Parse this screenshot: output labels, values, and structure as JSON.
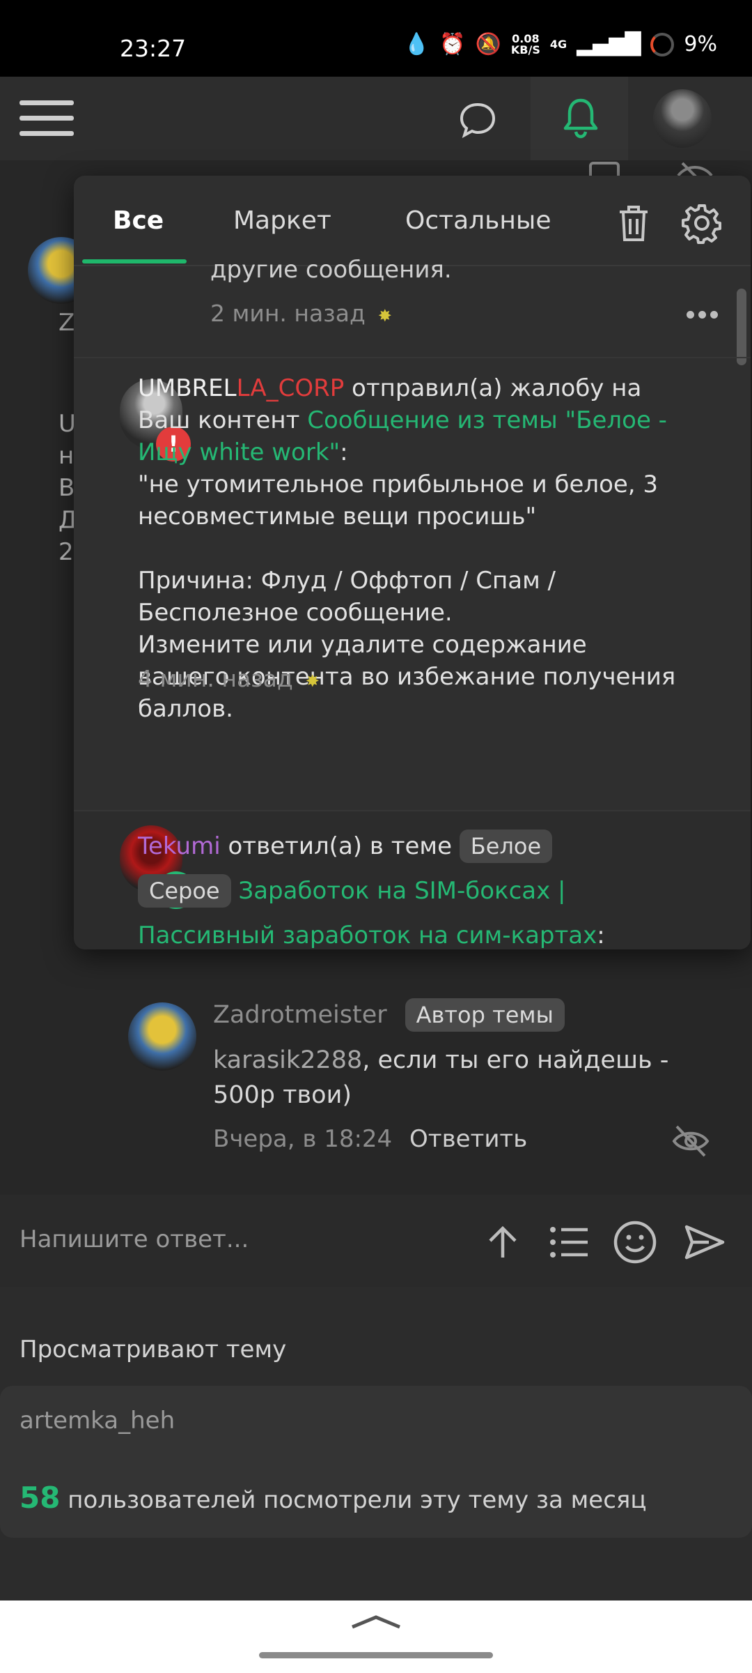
{
  "status_bar": {
    "time": "23:27",
    "speed_value": "0.08",
    "speed_unit": "KB/S",
    "network": "4G",
    "battery": "9%"
  },
  "header": {
    "icons": [
      "menu-icon",
      "chat-icon",
      "bell-icon",
      "avatar"
    ]
  },
  "popup": {
    "tabs": [
      "Все",
      "Маркет",
      "Остальные"
    ],
    "active_tab": "Все",
    "notifications": [
      {
        "text_partial": "другие сообщения.",
        "time": "2 мин. назад"
      },
      {
        "user": "UMBRELLA_CORP",
        "user_part1": "UMBREL",
        "user_part2": "LA_CORP",
        "action": " отправил(а) жалобу на Ваш контент ",
        "link": "Сообщение из темы \"Белое - Ищу white work\"",
        "colon": ":",
        "quote": "\"не утомительное прибыльное и белое, 3 несовместимые вещи просишь\"",
        "reason_line1": "Причина: Флуд / Оффтоп / Спам / Бесполезное сообщение.",
        "reason_line2": "Измените или удалите содержание вашего контента во избежание получения баллов.",
        "time": "4 мин. назад"
      },
      {
        "user": "Tekumi",
        "action": " ответил(а) в теме ",
        "tag1": "Белое",
        "tag2": "Серое",
        "link": "Заработок на SIM-боксах | Пассивный заработок на сим-картах",
        "colon": ":"
      }
    ]
  },
  "thread_post": {
    "author": "Zadrotmeister",
    "author_badge": "Автор темы",
    "mention": "karasik2288",
    "text": ", если ты его найдешь - 500р твои)",
    "time": "Вчера, в 18:24",
    "reply_label": "Ответить"
  },
  "reply_box": {
    "placeholder": "Напишите ответ..."
  },
  "viewers": {
    "title": "Просматривают тему",
    "users": "artemka_heh",
    "count": "58",
    "count_text": " пользователей посмотрели эту тему за месяц"
  },
  "colors": {
    "accent_green": "#25b874",
    "user_red": "#e23c3c",
    "user_purple": "#b26ad6"
  }
}
